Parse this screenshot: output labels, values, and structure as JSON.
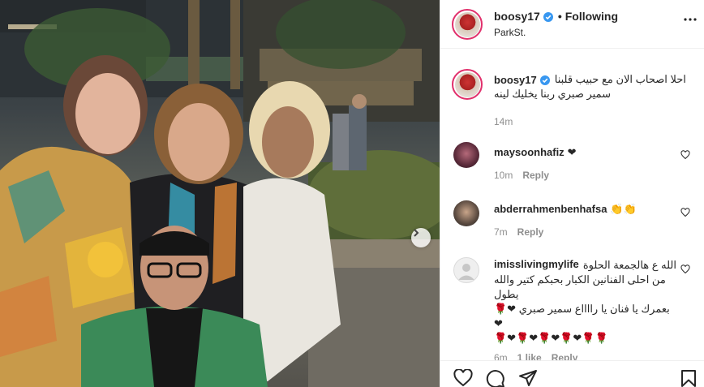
{
  "post": {
    "username": "boosy17",
    "follow_state": "Following",
    "separator": "•",
    "location": "ParkSt."
  },
  "caption": {
    "username": "boosy17",
    "line1": "احلا اصحاب الان مع حبيب قلبنا",
    "line2": "سمير صبري ربنا يخليك لينه",
    "time": "14m"
  },
  "comments": [
    {
      "username": "maysoonhafiz",
      "text": "❤",
      "time": "10m",
      "likes": "",
      "reply": "Reply"
    },
    {
      "username": "abderrahmenbenhafsa",
      "text": "👏👏",
      "time": "7m",
      "likes": "",
      "reply": "Reply"
    },
    {
      "username": "imisslivingmylife",
      "line1": "الله ع هالجمعة الحلوة",
      "line2": "من احلى الفنانين الكبار بحبكم كتير والله يطول",
      "line3": "بعمرك يا فنان يا رااااع سمير صبري ❤🌹❤",
      "line4": "🌹❤🌹❤🌹❤🌹❤🌹🌹",
      "time": "6m",
      "likes": "1 like",
      "reply": "Reply"
    }
  ],
  "colors": {
    "verified_blue": "#3897f0",
    "story_ring": "#e1306c",
    "muted_text": "#8e8e8e"
  }
}
